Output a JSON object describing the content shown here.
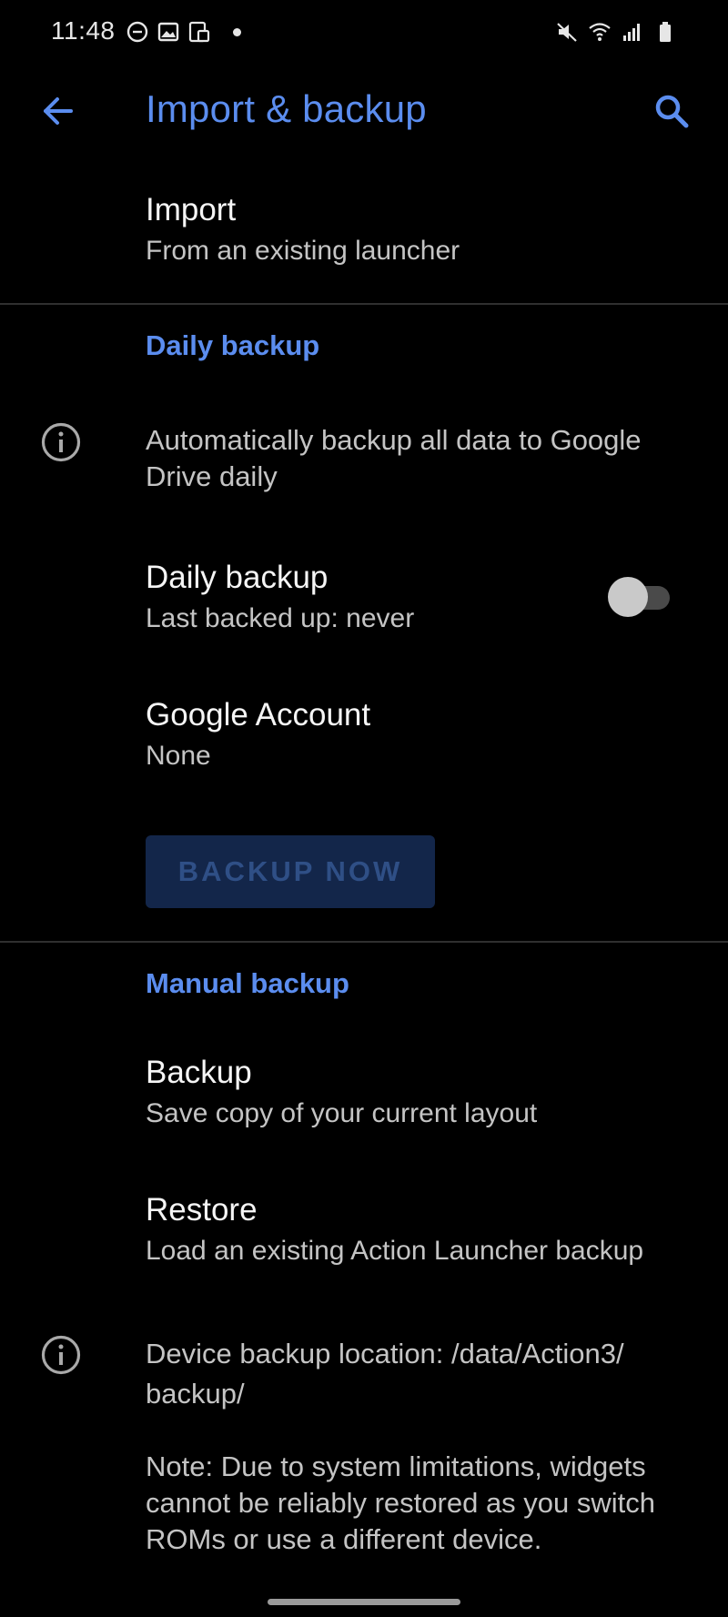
{
  "status_bar": {
    "time": "11:48",
    "left_icons": [
      "do-not-disturb-icon",
      "image-icon",
      "screenshot-icon",
      "notification-dot-icon"
    ],
    "right_icons": [
      "mute-icon",
      "wifi-icon",
      "signal-icon",
      "battery-icon"
    ]
  },
  "app_bar": {
    "title": "Import & backup",
    "back_icon": "back-arrow-icon",
    "search_icon": "search-icon"
  },
  "import": {
    "title": "Import",
    "summary": "From an existing launcher"
  },
  "daily_section": {
    "header": "Daily backup",
    "info_text": "Automatically backup all data to Google Drive daily",
    "daily_backup": {
      "title": "Daily backup",
      "summary": "Last backed up: never",
      "enabled": false
    },
    "google_account": {
      "title": "Google Account",
      "summary": "None"
    },
    "backup_now_label": "BACKUP NOW"
  },
  "manual_section": {
    "header": "Manual backup",
    "backup": {
      "title": "Backup",
      "summary": "Save copy of your current layout"
    },
    "restore": {
      "title": "Restore",
      "summary": "Load an existing Action Launcher backup"
    },
    "location_text": "Device backup location: /data/Action3/ backup/",
    "note_text": "Note: Due to system limitations, widgets cannot be reliably restored as you switch ROMs or use a different device."
  },
  "colors": {
    "accent": "#5b8def",
    "background": "#000000",
    "text_primary": "#f5f5f5",
    "text_secondary": "#c4c4c4",
    "disabled_button_bg": "#13264a",
    "disabled_button_text": "#2f4f86"
  }
}
